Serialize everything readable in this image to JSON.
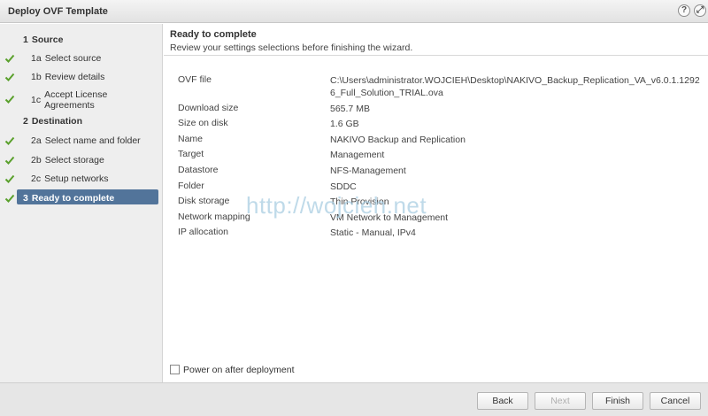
{
  "window": {
    "title": "Deploy OVF Template",
    "help_glyph": "?",
    "expand_glyph": "⤢"
  },
  "sidebar": {
    "steps": [
      {
        "num": "1",
        "text": "Source",
        "type": "header"
      },
      {
        "num": "1a",
        "text": "Select source",
        "type": "sub",
        "done": true
      },
      {
        "num": "1b",
        "text": "Review details",
        "type": "sub",
        "done": true
      },
      {
        "num": "1c",
        "text": "Accept License Agreements",
        "type": "sub",
        "done": true
      },
      {
        "num": "2",
        "text": "Destination",
        "type": "header"
      },
      {
        "num": "2a",
        "text": "Select name and folder",
        "type": "sub",
        "done": true
      },
      {
        "num": "2b",
        "text": "Select storage",
        "type": "sub",
        "done": true
      },
      {
        "num": "2c",
        "text": "Setup networks",
        "type": "sub",
        "done": true
      },
      {
        "num": "3",
        "text": "Ready to complete",
        "type": "header",
        "done": true,
        "active": true
      }
    ]
  },
  "main": {
    "heading": "Ready to complete",
    "subheading": "Review your settings selections before finishing the wizard.",
    "summary": [
      {
        "key": "OVF file",
        "value": "C:\\Users\\administrator.WOJCIEH\\Desktop\\NAKIVO_Backup_Replication_VA_v6.0.1.12926_Full_Solution_TRIAL.ova"
      },
      {
        "key": "Download size",
        "value": "565.7 MB"
      },
      {
        "key": "Size on disk",
        "value": "1.6 GB"
      },
      {
        "key": "Name",
        "value": "NAKIVO Backup and Replication"
      },
      {
        "key": "Target",
        "value": "Management"
      },
      {
        "key": "Datastore",
        "value": "NFS-Management"
      },
      {
        "key": "Folder",
        "value": "SDDC"
      },
      {
        "key": "Disk storage",
        "value": "Thin Provision"
      },
      {
        "key": "Network mapping",
        "value": "VM Network to Management"
      },
      {
        "key": "IP allocation",
        "value": "Static - Manual, IPv4"
      }
    ],
    "watermark": "http://wojcieh.net",
    "power_on_label": "Power on after deployment",
    "power_on_checked": false
  },
  "footer": {
    "back": "Back",
    "next": "Next",
    "finish": "Finish",
    "cancel": "Cancel"
  },
  "colors": {
    "active_step": "#52749a",
    "check": "#5aa02c"
  }
}
